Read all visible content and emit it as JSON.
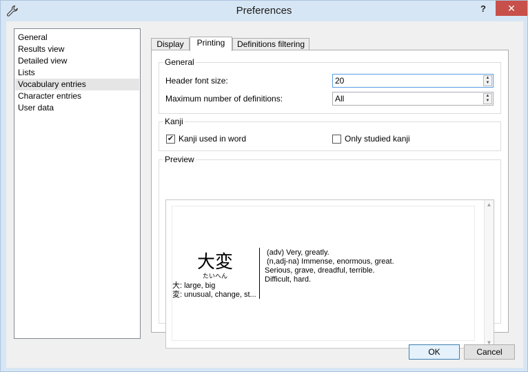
{
  "window": {
    "title": "Preferences",
    "help_label": "?",
    "close_label": "✕"
  },
  "sidebar": {
    "items": [
      {
        "label": "General"
      },
      {
        "label": "Results view"
      },
      {
        "label": "Detailed view"
      },
      {
        "label": "Lists"
      },
      {
        "label": "Vocabulary entries"
      },
      {
        "label": "Character entries"
      },
      {
        "label": "User data"
      }
    ],
    "selected_index": 4
  },
  "tabs": [
    {
      "label": "Display"
    },
    {
      "label": "Printing"
    },
    {
      "label": "Definitions filtering"
    }
  ],
  "active_tab": 1,
  "general": {
    "group_label": "General",
    "header_font_label": "Header font size:",
    "header_font_value": "20",
    "max_defs_label": "Maximum number of definitions:",
    "max_defs_value": "All"
  },
  "kanji": {
    "group_label": "Kanji",
    "used_in_word_label": "Kanji used in word",
    "used_in_word_checked": true,
    "only_studied_label": "Only studied kanji",
    "only_studied_checked": false
  },
  "preview": {
    "group_label": "Preview",
    "headword": "大変",
    "reading": "たいへん",
    "kanji_lines": [
      "大: large, big",
      "変: unusual, change, st..."
    ],
    "definitions": [
      "(adv) Very, greatly.",
      "(n,adj-na) Immense, enormous, great.",
      "Serious, grave, dreadful, terrible.",
      "Difficult, hard."
    ]
  },
  "buttons": {
    "ok_label": "OK",
    "cancel_label": "Cancel"
  },
  "colors": {
    "title_bar": "#d7e6f4",
    "close_button": "#c7504a",
    "focus_border": "#569de5"
  }
}
